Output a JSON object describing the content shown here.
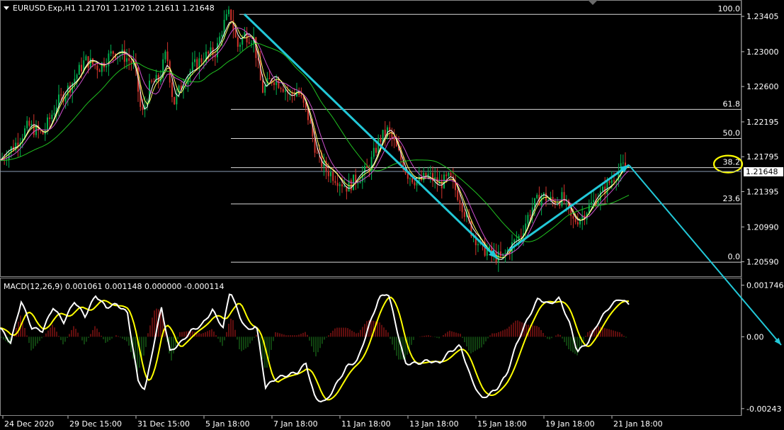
{
  "symbol_header": "EURUSD.Exp,H1  1.21701 1.21702 1.21611 1.21648",
  "macd_header": "MACD(12,26,9) 0.001061 0.001148 0.000000 -0.000114",
  "current_price": "1.21648",
  "fib_labels": [
    "100.0",
    "61.8",
    "50.0",
    "38.2",
    "23.6",
    "0.0"
  ],
  "price_axis_labels": [
    "1.23405",
    "1.23000",
    "1.22600",
    "1.22195",
    "1.21795",
    "1.21395",
    "1.20990",
    "1.20590"
  ],
  "macd_axis_labels": [
    "0.001746",
    "0.00",
    "-0.00243"
  ],
  "time_axis_labels": [
    "24 Dec 2020",
    "29 Dec 15:00",
    "31 Dec 15:00",
    "5 Jan 18:00",
    "7 Jan 18:00",
    "11 Jan 18:00",
    "13 Jan 18:00",
    "15 Jan 18:00",
    "19 Jan 18:00",
    "21 Jan 18:00"
  ],
  "colors": {
    "background": "#000000",
    "bull": "#00b050",
    "bear": "#d0342c",
    "ma_fast": "#ffffff",
    "ma_mid": "#ffff60",
    "ma_slow": "#20c020",
    "ma_extra": "#d050d0",
    "arrow": "#22c8d8",
    "highlight": "#ffff00",
    "macd_hist_pos": "#a01818",
    "macd_hist_neg": "#1a6d1a",
    "macd_line": "#ffffff",
    "signal_line": "#ffff00"
  },
  "chart_data": {
    "type": "candlestick",
    "symbol": "EURUSD.Exp",
    "timeframe": "H1",
    "ohlc_current": {
      "open": 1.21701,
      "high": 1.21702,
      "low": 1.21611,
      "close": 1.21648
    },
    "ylim": [
      1.2044,
      1.2356
    ],
    "y_ticks": [
      1.23405,
      1.23,
      1.226,
      1.22195,
      1.21795,
      1.21395,
      1.2099,
      1.2059
    ],
    "x_ticks": [
      "24 Dec 2020",
      "29 Dec 15:00",
      "31 Dec 15:00",
      "5 Jan 18:00",
      "7 Jan 18:00",
      "11 Jan 18:00",
      "13 Jan 18:00",
      "15 Jan 18:00",
      "19 Jan 18:00",
      "21 Jan 18:00"
    ],
    "close_path": [
      [
        0,
        1.2175
      ],
      [
        20,
        1.2192
      ],
      [
        40,
        1.2215
      ],
      [
        60,
        1.2205
      ],
      [
        80,
        1.224
      ],
      [
        100,
        1.2262
      ],
      [
        120,
        1.229
      ],
      [
        140,
        1.2282
      ],
      [
        160,
        1.23
      ],
      [
        175,
        1.2295
      ],
      [
        190,
        1.2285
      ],
      [
        200,
        1.2225
      ],
      [
        212,
        1.2262
      ],
      [
        225,
        1.2268
      ],
      [
        235,
        1.23
      ],
      [
        245,
        1.224
      ],
      [
        258,
        1.2265
      ],
      [
        272,
        1.2282
      ],
      [
        290,
        1.2295
      ],
      [
        305,
        1.23
      ],
      [
        315,
        1.233
      ],
      [
        325,
        1.2345
      ],
      [
        335,
        1.2305
      ],
      [
        345,
        1.232
      ],
      [
        358,
        1.2315
      ],
      [
        370,
        1.2255
      ],
      [
        385,
        1.227
      ],
      [
        398,
        1.2262
      ],
      [
        410,
        1.225
      ],
      [
        420,
        1.2255
      ],
      [
        435,
        1.2225
      ],
      [
        448,
        1.218
      ],
      [
        460,
        1.2165
      ],
      [
        475,
        1.2155
      ],
      [
        490,
        1.2145
      ],
      [
        505,
        1.2155
      ],
      [
        520,
        1.2165
      ],
      [
        535,
        1.2198
      ],
      [
        548,
        1.221
      ],
      [
        560,
        1.2188
      ],
      [
        575,
        1.216
      ],
      [
        590,
        1.215
      ],
      [
        605,
        1.2158
      ],
      [
        620,
        1.2148
      ],
      [
        635,
        1.2155
      ],
      [
        650,
        1.213
      ],
      [
        665,
        1.2095
      ],
      [
        680,
        1.2075
      ],
      [
        695,
        1.2068
      ],
      [
        708,
        1.2062
      ],
      [
        720,
        1.2075
      ],
      [
        735,
        1.209
      ],
      [
        750,
        1.212
      ],
      [
        765,
        1.2135
      ],
      [
        780,
        1.2128
      ],
      [
        795,
        1.2132
      ],
      [
        808,
        1.2105
      ],
      [
        820,
        1.211
      ],
      [
        835,
        1.2125
      ],
      [
        850,
        1.2138
      ],
      [
        865,
        1.2155
      ],
      [
        880,
        1.2168
      ],
      [
        887,
        1.2165
      ]
    ],
    "fibonacci": {
      "levels": [
        100.0,
        61.8,
        50.0,
        38.2,
        23.6,
        0.0
      ],
      "prices": [
        1.23428,
        1.22338,
        1.22004,
        1.2167,
        1.21254,
        1.20585
      ]
    },
    "macd": {
      "params": [
        12,
        26,
        9
      ],
      "values": {
        "macd": 0.001061,
        "signal": 0.001148,
        "a": 0.0,
        "b": -0.000114
      },
      "ylim": [
        -0.00265,
        0.00195
      ],
      "y_ticks": [
        0.001746,
        0.0,
        -0.00243
      ],
      "macd_path": [
        [
          0,
          0.0003
        ],
        [
          15,
          -0.0002
        ],
        [
          30,
          0.0012
        ],
        [
          45,
          0.0003
        ],
        [
          60,
          0.0002
        ],
        [
          75,
          0.001
        ],
        [
          90,
          0.0005
        ],
        [
          105,
          0.0012
        ],
        [
          120,
          0.0007
        ],
        [
          135,
          0.0014
        ],
        [
          150,
          0.001
        ],
        [
          165,
          0.0011
        ],
        [
          180,
          0.0008
        ],
        [
          195,
          -0.0015
        ],
        [
          205,
          -0.0018
        ],
        [
          215,
          -0.0005
        ],
        [
          228,
          0.001
        ],
        [
          240,
          -0.0005
        ],
        [
          255,
          -0.0002
        ],
        [
          270,
          0.0002
        ],
        [
          285,
          0.0004
        ],
        [
          300,
          0.0009
        ],
        [
          315,
          0.0003
        ],
        [
          325,
          0.0016
        ],
        [
          338,
          0.0007
        ],
        [
          350,
          0.0002
        ],
        [
          362,
          0.0004
        ],
        [
          375,
          -0.0017
        ],
        [
          390,
          -0.0014
        ],
        [
          405,
          -0.0013
        ],
        [
          420,
          -0.0012
        ],
        [
          432,
          -0.0009
        ],
        [
          445,
          -0.0021
        ],
        [
          460,
          -0.0022
        ],
        [
          475,
          -0.0016
        ],
        [
          490,
          -0.001
        ],
        [
          505,
          -0.0008
        ],
        [
          520,
          0.0003
        ],
        [
          535,
          0.0013
        ],
        [
          548,
          0.0015
        ],
        [
          560,
          0.0003
        ],
        [
          572,
          -0.0009
        ],
        [
          590,
          -0.0009
        ],
        [
          605,
          -0.0008
        ],
        [
          620,
          -0.0009
        ],
        [
          635,
          -0.0005
        ],
        [
          650,
          -0.0003
        ],
        [
          665,
          -0.0014
        ],
        [
          680,
          -0.0021
        ],
        [
          700,
          -0.0018
        ],
        [
          715,
          -0.0013
        ],
        [
          730,
          -0.0002
        ],
        [
          745,
          0.0006
        ],
        [
          760,
          0.0013
        ],
        [
          775,
          0.0011
        ],
        [
          790,
          0.0013
        ],
        [
          805,
          0.0004
        ],
        [
          815,
          -0.0005
        ],
        [
          830,
          -0.0002
        ],
        [
          845,
          0.0005
        ],
        [
          860,
          0.001
        ],
        [
          875,
          0.0013
        ],
        [
          887,
          0.0011
        ]
      ]
    }
  }
}
